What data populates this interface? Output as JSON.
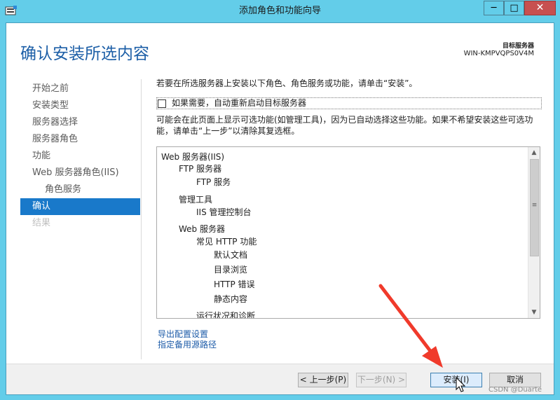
{
  "window": {
    "title": "添加角色和功能向导",
    "controls": {
      "minimize": "─",
      "maximize": "□",
      "close": "✕"
    }
  },
  "header": {
    "page_title": "确认安装所选内容",
    "target_label": "目标服务器",
    "target_value": "WIN-KMPVQPS0V4M"
  },
  "nav": {
    "items": [
      {
        "label": "开始之前"
      },
      {
        "label": "安装类型"
      },
      {
        "label": "服务器选择"
      },
      {
        "label": "服务器角色"
      },
      {
        "label": "功能"
      },
      {
        "label": "Web 服务器角色(IIS)"
      },
      {
        "label": "角色服务"
      },
      {
        "label": "确认"
      },
      {
        "label": "结果"
      }
    ]
  },
  "main": {
    "instruction": "若要在所选服务器上安装以下角色、角色服务或功能，请单击“安装”。",
    "restart_label": "如果需要，自动重新启动目标服务器",
    "notice_line1": "可能会在此页面上显示可选功能(如管理工具)，因为已自动选择这些功能。如果不希望安装这些可选功",
    "notice_line2": "能，请单击“上一步”以清除其复选框。",
    "list": [
      "Web 服务器(IIS)",
      "FTP 服务器",
      "FTP 服务",
      "管理工具",
      "IIS 管理控制台",
      "Web 服务器",
      "常见 HTTP 功能",
      "默认文档",
      "目录浏览",
      "HTTP 错误",
      "静态内容",
      "运行状况和诊断"
    ],
    "export_link": "导出配置设置",
    "alt_source_link": "指定备用源路径"
  },
  "footer": {
    "prev": "< 上一步(P)",
    "next": "下一步(N) >",
    "install": "安装(I)",
    "cancel": "取消"
  },
  "watermark": "CSDN @Duarte",
  "colors": {
    "frame": "#63cde9",
    "title_blue": "#1d5fa7",
    "active_nav": "#1979ca",
    "arrow": "#f03a2b"
  },
  "icons": {
    "app": "server-manager-icon",
    "scroll_up": "chevron-up-icon",
    "scroll_down": "chevron-down-icon",
    "pointer": "mouse-pointer-icon"
  }
}
